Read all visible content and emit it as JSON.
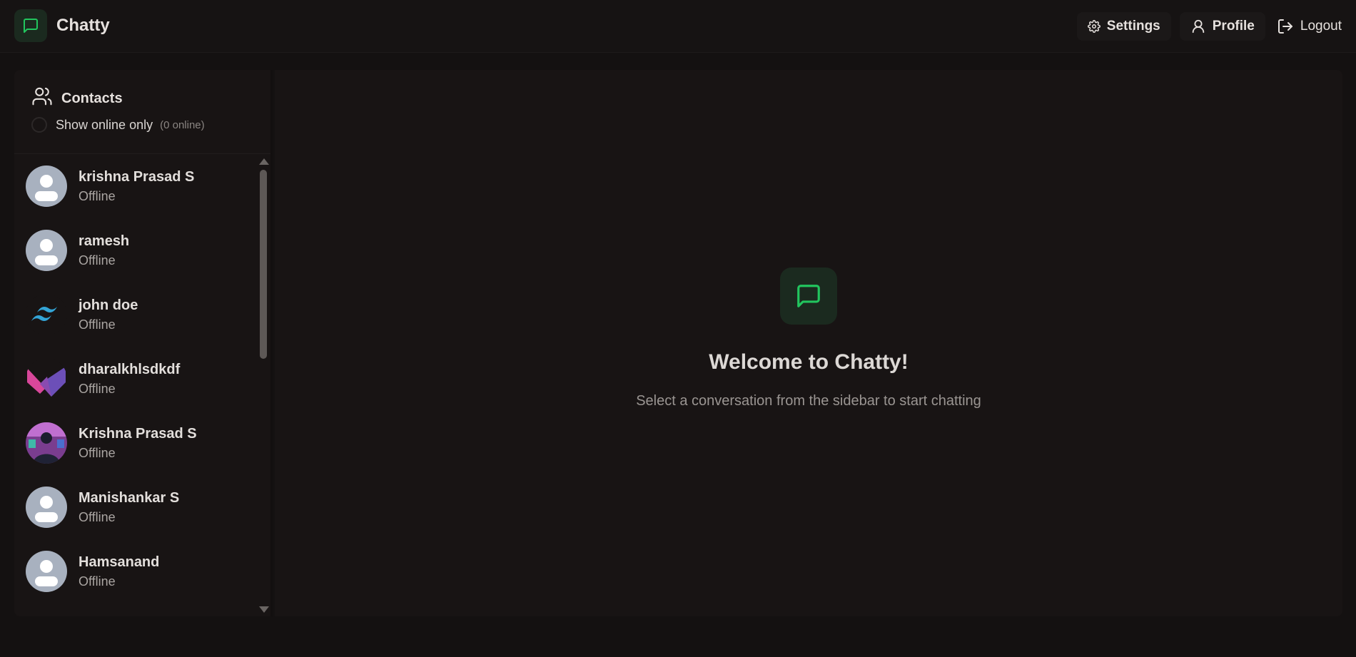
{
  "app": {
    "name": "Chatty",
    "accent": "#22c55e"
  },
  "nav": {
    "settings_label": "Settings",
    "profile_label": "Profile",
    "logout_label": "Logout"
  },
  "sidebar": {
    "title": "Contacts",
    "filter_label": "Show online only",
    "online_count": "(0 online)",
    "contacts": [
      {
        "name": "krishna Prasad S",
        "status": "Offline",
        "avatar": "default-avatar"
      },
      {
        "name": "ramesh",
        "status": "Offline",
        "avatar": "default-avatar"
      },
      {
        "name": "john doe",
        "status": "Offline",
        "avatar": "tailwind-logo"
      },
      {
        "name": "dharalkhlsdkdf",
        "status": "Offline",
        "avatar": "abstract-logo"
      },
      {
        "name": "Krishna Prasad S",
        "status": "Offline",
        "avatar": "photo"
      },
      {
        "name": "Manishankar S",
        "status": "Offline",
        "avatar": "default-avatar"
      },
      {
        "name": "Hamsanand",
        "status": "Offline",
        "avatar": "default-avatar"
      }
    ]
  },
  "main": {
    "welcome_title": "Welcome to Chatty!",
    "welcome_subtitle": "Select a conversation from the sidebar to start chatting"
  }
}
